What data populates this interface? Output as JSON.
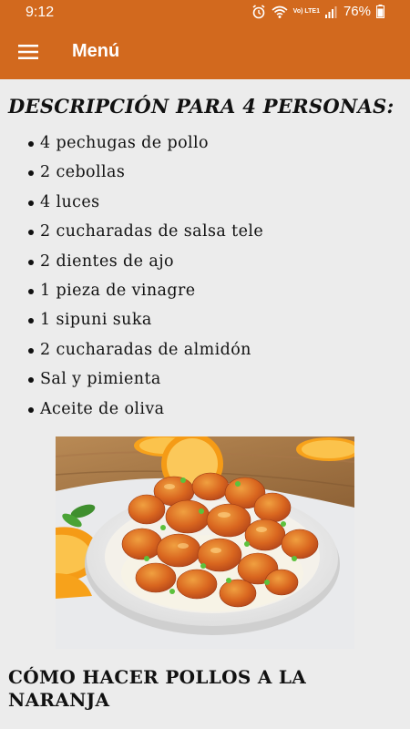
{
  "status_bar": {
    "time": "9:12",
    "volte_label": "Vo) LTE1",
    "battery": "76%",
    "icons": [
      "alarm-icon",
      "wifi-icon",
      "signal-icon",
      "battery-icon"
    ]
  },
  "app_bar": {
    "title": "Menú",
    "menu_icon": "hamburger-icon",
    "color": "#d2691e"
  },
  "section": {
    "heading": "DESCRIPCIÓN PARA 4 PERSONAS:"
  },
  "ingredients": [
    "4 pechugas de pollo",
    "2 cebollas",
    "4 luces",
    "2 cucharadas de salsa tele",
    "2 dientes de ajo",
    "1 pieza de vinagre",
    "1 sipuni suka",
    "2 cucharadas de almidón",
    "Sal y pimienta",
    "Aceite de oliva"
  ],
  "recipe": {
    "title": "CÓMO HACER POLLOS A LA NARANJA"
  }
}
